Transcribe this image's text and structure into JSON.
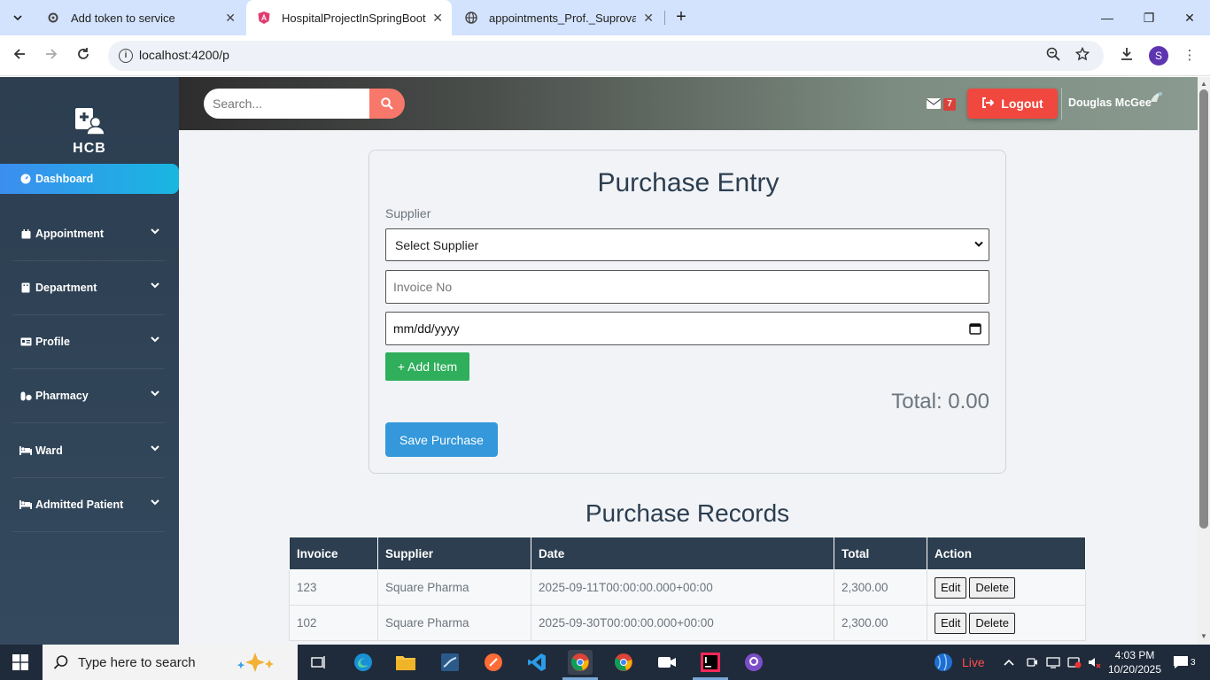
{
  "browser": {
    "tabs": [
      {
        "label": "Add token to service"
      },
      {
        "label": "HospitalProjectInSpringBoot"
      },
      {
        "label": "appointments_Prof._Suprova_Sh"
      }
    ],
    "url": "localhost:4200/p",
    "profile_initial": "S"
  },
  "sidebar": {
    "brand": "HCB",
    "active": {
      "label": "Dashboard",
      "icon": "dashboard-icon"
    },
    "items": [
      {
        "label": "Appointment",
        "icon": "calendar-icon"
      },
      {
        "label": "Department",
        "icon": "building-icon"
      },
      {
        "label": "Profile",
        "icon": "id-card-icon"
      },
      {
        "label": "Pharmacy",
        "icon": "pills-icon"
      },
      {
        "label": "Ward",
        "icon": "bed-icon"
      },
      {
        "label": "Admitted Patient",
        "icon": "bed-icon"
      }
    ]
  },
  "header": {
    "search_placeholder": "Search...",
    "mail_count": "7",
    "logout_label": "Logout",
    "user_name": "Douglas McGee"
  },
  "form": {
    "title": "Purchase Entry",
    "supplier_label": "Supplier",
    "supplier_selected": "Select Supplier",
    "invoice_placeholder": "Invoice No",
    "date_placeholder": "mm/dd/yyyy",
    "add_item_label": "+ Add Item",
    "total_label": "Total: 0.00",
    "save_label": "Save Purchase"
  },
  "records": {
    "title": "Purchase Records",
    "columns": [
      "Invoice",
      "Supplier",
      "Date",
      "Total",
      "Action"
    ],
    "rows": [
      {
        "invoice": "123",
        "supplier": "Square Pharma",
        "date": "2025-09-11T00:00:00.000+00:00",
        "total": "2,300.00"
      },
      {
        "invoice": "102",
        "supplier": "Square Pharma",
        "date": "2025-09-30T00:00:00.000+00:00",
        "total": "2,300.00"
      }
    ],
    "edit_label": "Edit",
    "delete_label": "Delete"
  },
  "taskbar": {
    "search_placeholder": "Type here to search",
    "live_label": "Live",
    "time": "4:03 PM",
    "date": "10/20/2025",
    "notification_count": "3"
  },
  "colors": {
    "sidebar_bg": "#2c3e50",
    "active_nav": "#3b8ef0",
    "logout": "#f0483e",
    "add_button": "#2fae5b",
    "save_button": "#3498db",
    "table_header": "#2c3e50"
  }
}
